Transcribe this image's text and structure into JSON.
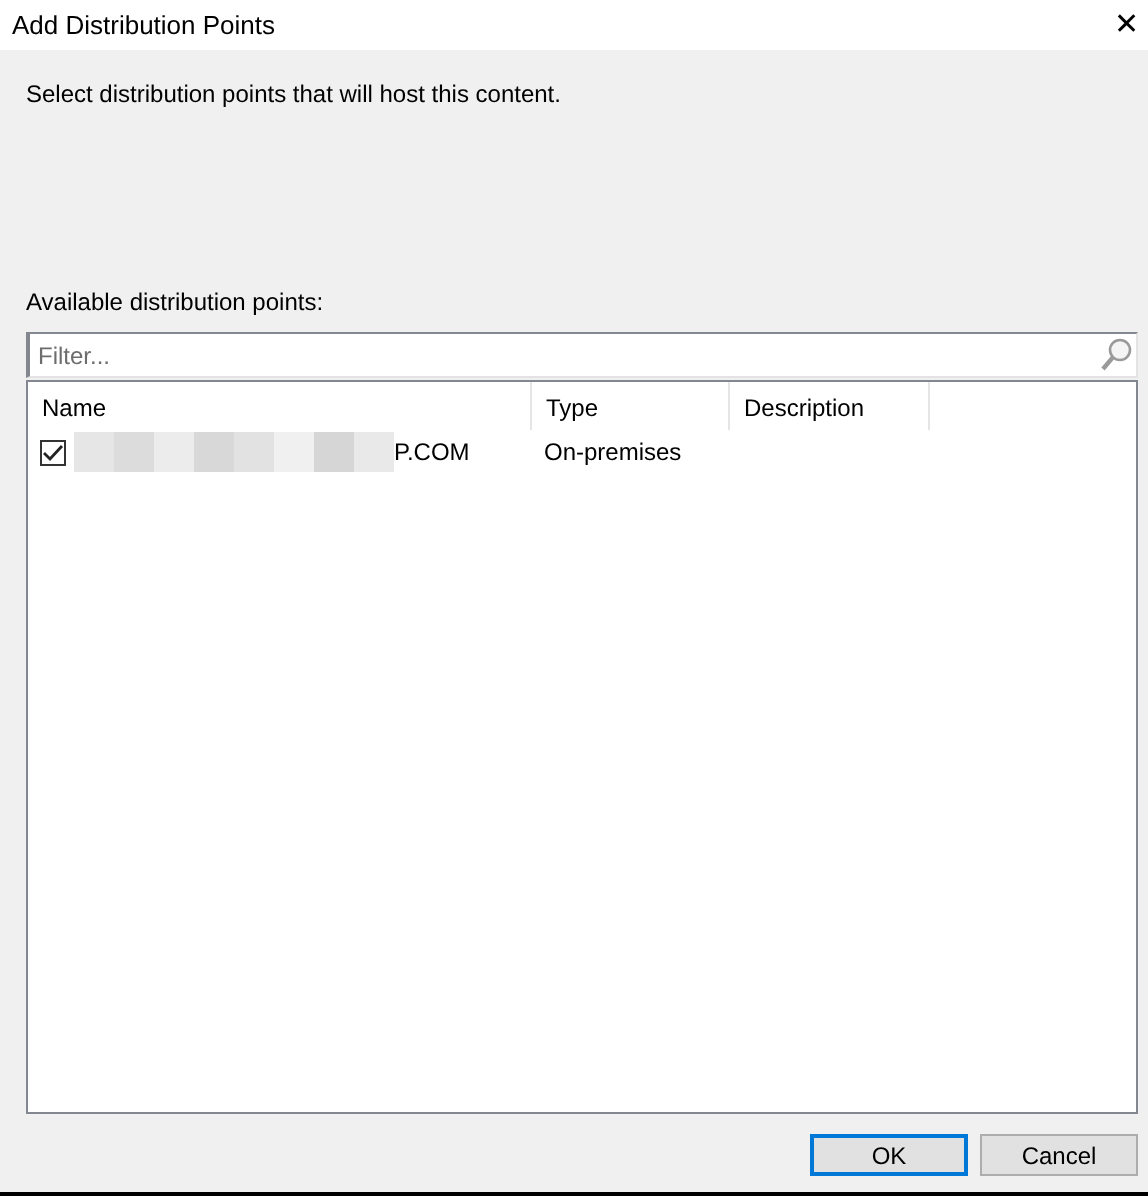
{
  "window": {
    "title": "Add Distribution Points",
    "close": "✕"
  },
  "instruction": "Select distribution points that will host this content.",
  "list_label": "Available distribution points:",
  "filter": {
    "placeholder": "Filter..."
  },
  "table": {
    "columns": [
      "Name",
      "Type",
      "Description"
    ],
    "rows": [
      {
        "checked": true,
        "name": "P.COM",
        "type": "On-premises"
      }
    ]
  },
  "buttons": [
    {
      "label": "OK",
      "default": true
    },
    {
      "label": "Cancel",
      "default": false
    }
  ]
}
